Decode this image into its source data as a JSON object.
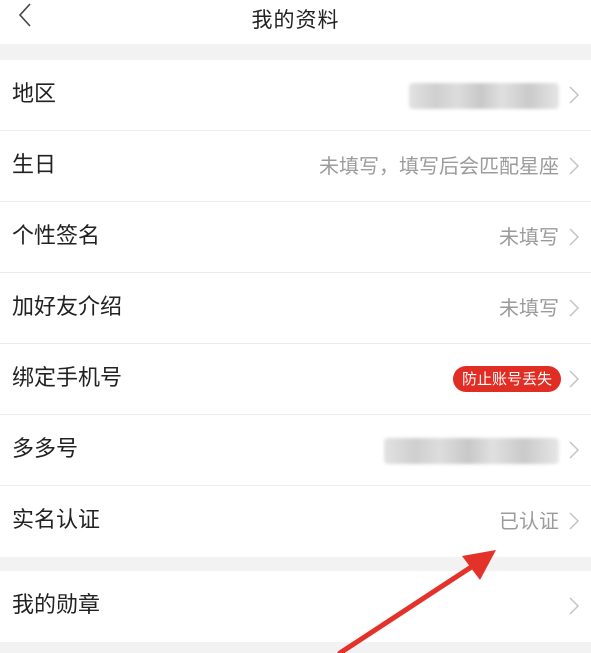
{
  "header": {
    "title": "我的资料",
    "back_icon": "chevron-left-icon"
  },
  "rows": [
    {
      "label": "地区",
      "value": "",
      "value_blurred": true
    },
    {
      "label": "生日",
      "value": "未填写，填写后会匹配星座"
    },
    {
      "label": "个性签名",
      "value": "未填写"
    },
    {
      "label": "加好友介绍",
      "value": "未填写"
    },
    {
      "label": "绑定手机号",
      "badge": "防止账号丢失"
    },
    {
      "label": "多多号",
      "value": "",
      "value_blurred": true
    },
    {
      "label": "实名认证",
      "value": "已认证"
    }
  ],
  "rows_after_gap": [
    {
      "label": "我的勋章",
      "value": ""
    }
  ],
  "colors": {
    "badge_bg": "#e02e24",
    "arrow": "#e4322b",
    "value_text": "#9b9b9b"
  },
  "annotation": {
    "type": "red-arrow",
    "points_to": "实名认证"
  }
}
